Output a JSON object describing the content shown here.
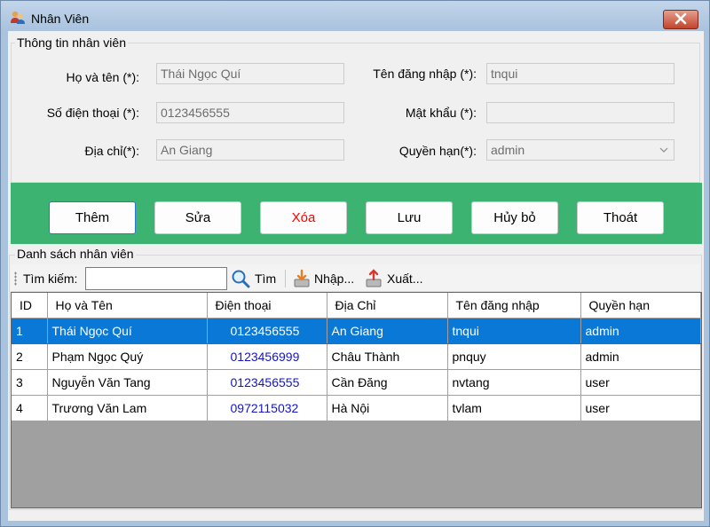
{
  "window": {
    "title": "Nhân Viên"
  },
  "info_group": {
    "title": "Thông tin nhân viên",
    "fullname_label": "Họ và tên (*):",
    "fullname_value": "Thái Ngọc Quí",
    "phone_label": "Số điện thoại (*):",
    "phone_value": "0123456555",
    "address_label": "Địa chỉ(*):",
    "address_value": "An Giang",
    "username_label": "Tên đăng nhập (*):",
    "username_value": "tnqui",
    "password_label": "Mật khẩu (*):",
    "password_value": "",
    "role_label": "Quyền hạn(*):",
    "role_value": "admin"
  },
  "buttons": {
    "add": "Thêm",
    "edit": "Sửa",
    "delete": "Xóa",
    "save": "Lưu",
    "cancel": "Hủy bỏ",
    "exit": "Thoát"
  },
  "list_group": {
    "title": "Danh sách nhân viên"
  },
  "toolbar": {
    "search_label": "Tìm kiếm:",
    "search_value": "",
    "search_button": "Tìm",
    "import_button": "Nhập...",
    "export_button": "Xuất..."
  },
  "table": {
    "columns": [
      "ID",
      "Họ và Tên",
      "Điện thoại",
      "Địa Chỉ",
      "Tên đăng nhập",
      "Quyền hạn"
    ],
    "rows": [
      [
        "1",
        "Thái Ngọc Quí",
        "0123456555",
        "An Giang",
        "tnqui",
        "admin"
      ],
      [
        "2",
        "Phạm Ngọc Quý",
        "0123456999",
        "Châu Thành",
        "pnquy",
        "admin"
      ],
      [
        "3",
        "Nguyễn Văn Tang",
        "0123456555",
        "Cần Đăng",
        "nvtang",
        "user"
      ],
      [
        "4",
        "Trương Văn Lam",
        "0972115032",
        "Hà Nội",
        "tvlam",
        "user"
      ]
    ],
    "selected_row": 0
  },
  "colors": {
    "accent_green": "#3cb371",
    "selection_blue": "#0a78d7",
    "phone_text": "#1515c5",
    "delete_text": "#ff0000"
  }
}
